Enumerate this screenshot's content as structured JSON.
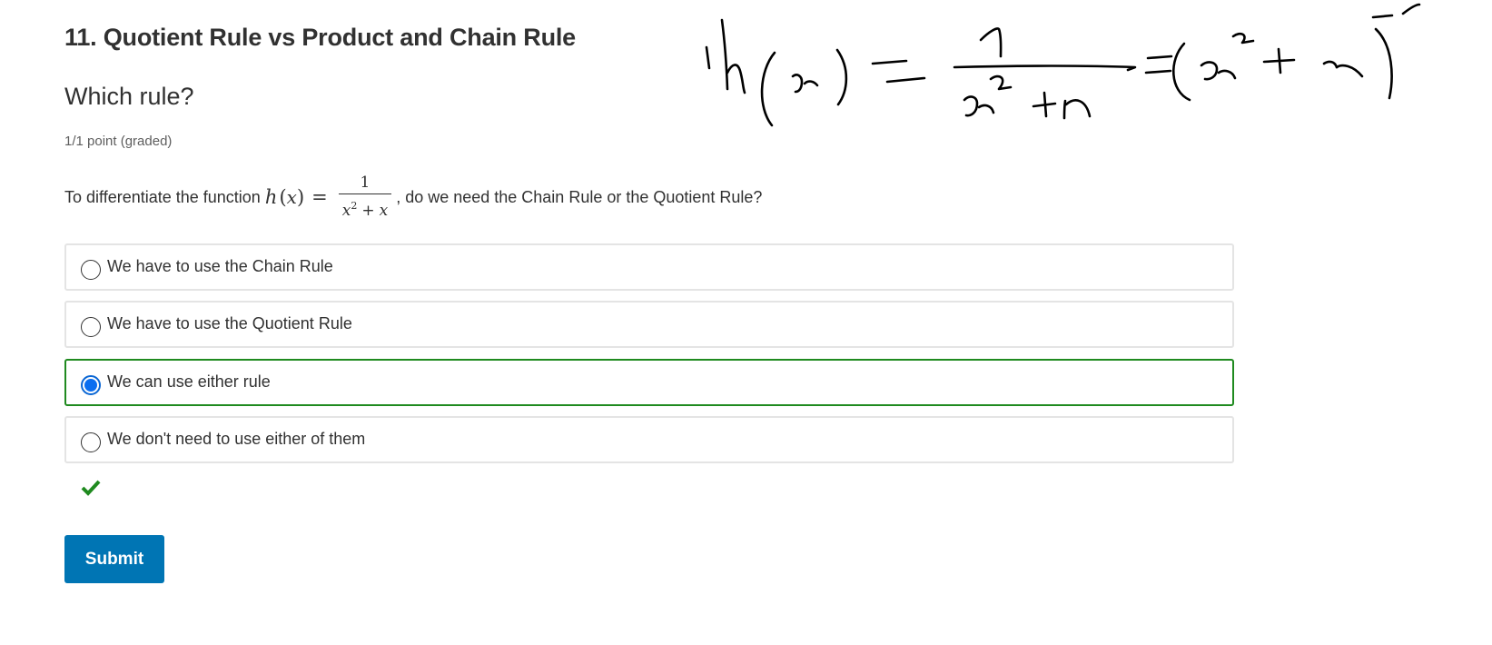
{
  "problem": {
    "section_title": "11. Quotient Rule vs Product and Chain Rule",
    "title": "Which rule?",
    "grade": "1/1 point (graded)",
    "question_prefix": "To differentiate the function",
    "question_suffix": ", do we need the Chain Rule or the Quotient Rule?",
    "math": {
      "function_name": "h",
      "variable": "x",
      "numerator": "1",
      "den_base": "x",
      "den_exponent": "2",
      "den_operator": "+",
      "den_term": "x"
    }
  },
  "options": [
    {
      "label": "We have to use the Chain Rule",
      "selected": false
    },
    {
      "label": "We have to use the Quotient Rule",
      "selected": false
    },
    {
      "label": "We can use either rule",
      "selected": true
    },
    {
      "label": "We don't need to use either of them",
      "selected": false
    }
  ],
  "result": {
    "status": "correct",
    "icon": "checkmark-icon",
    "color": "#1f8a1f"
  },
  "submit": {
    "label": "Submit",
    "color": "#0075b4"
  },
  "annotation": {
    "kind": "handwritten-overlay",
    "content": "h(x) = 1/(x^2+x) = (x^2+x)^-1",
    "color": "#000000"
  },
  "colors": {
    "selected_radio": "#0a6ef0",
    "selected_border": "#1f8a1f",
    "option_border": "#e4e4e4"
  }
}
